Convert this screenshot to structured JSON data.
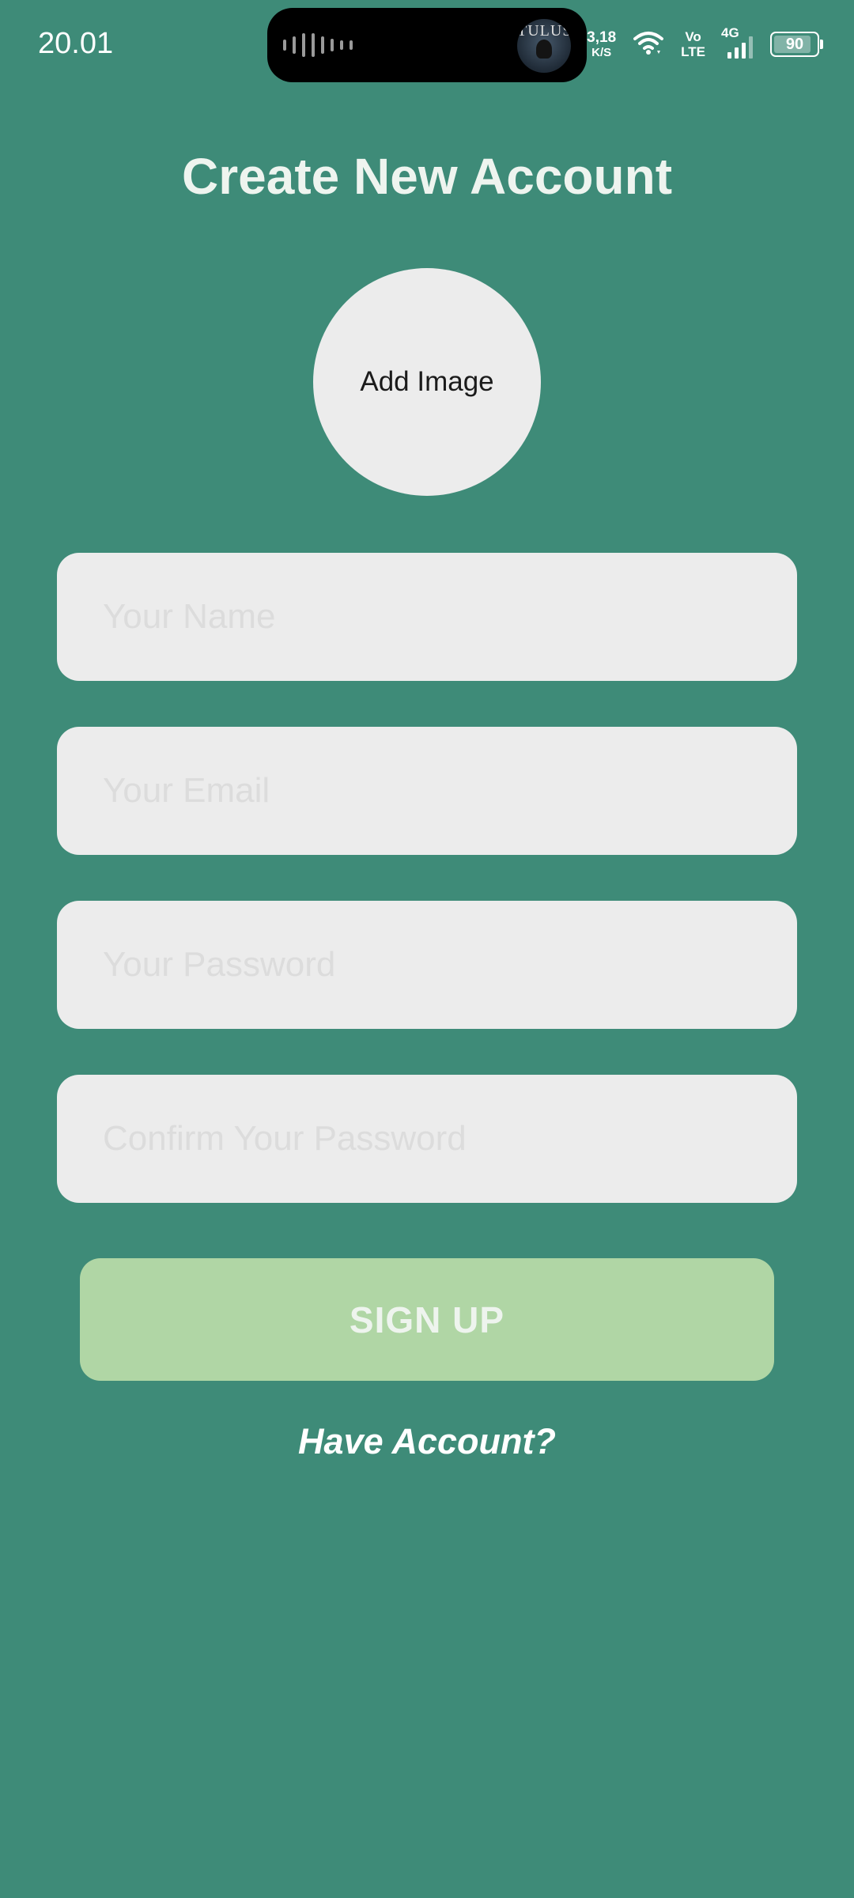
{
  "status_bar": {
    "time": "20.01",
    "island_avatar_text": "TULUS",
    "net_speed_value": "3,18",
    "net_speed_unit": "K/S",
    "volte_top": "Vo",
    "volte_bottom": "LTE",
    "network_type": "4G",
    "battery_level": "90",
    "icons": [
      "waveform-icon",
      "wifi-icon",
      "signal-icon",
      "battery-icon"
    ]
  },
  "page": {
    "title": "Create New Account",
    "add_image_label": "Add Image"
  },
  "form": {
    "name": {
      "placeholder": "Your Name",
      "value": ""
    },
    "email": {
      "placeholder": "Your Email",
      "value": ""
    },
    "password": {
      "placeholder": "Your Password",
      "value": ""
    },
    "confirm_password": {
      "placeholder": "Confirm Your Password",
      "value": ""
    }
  },
  "actions": {
    "signup_label": "SIGN UP",
    "have_account_label": "Have Account?"
  },
  "colors": {
    "background": "#3e8b78",
    "field_background": "#ececec",
    "button_background": "#b0d6a5",
    "title_text": "#eef4ef"
  }
}
